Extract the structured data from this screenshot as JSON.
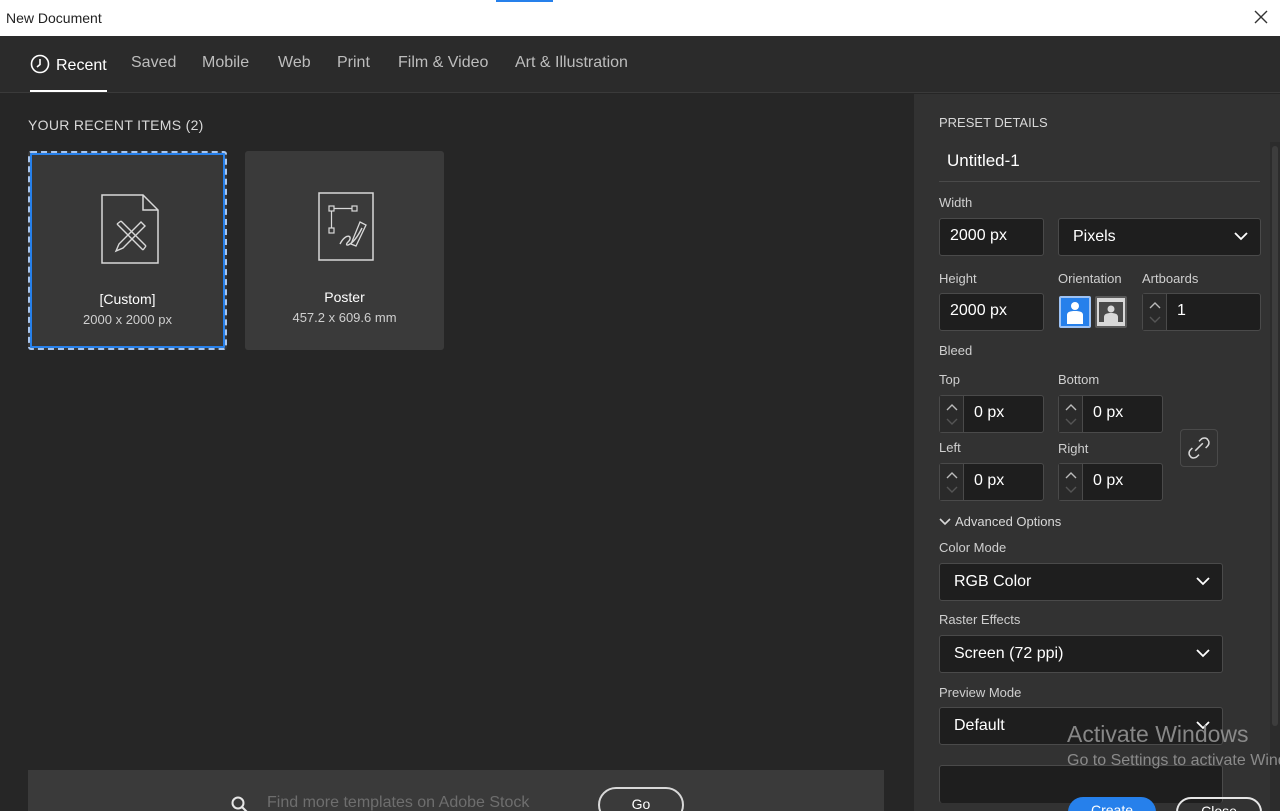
{
  "window": {
    "title": "New Document"
  },
  "tabs": [
    {
      "label": "Recent",
      "active": true
    },
    {
      "label": "Saved"
    },
    {
      "label": "Mobile"
    },
    {
      "label": "Web"
    },
    {
      "label": "Print"
    },
    {
      "label": "Film & Video"
    },
    {
      "label": "Art & Illustration"
    }
  ],
  "recent": {
    "heading": "YOUR RECENT ITEMS",
    "count": "(2)",
    "items": [
      {
        "name": "[Custom]",
        "size": "2000 x 2000 px",
        "icon": "document-ruler-pencil-icon",
        "selected": true
      },
      {
        "name": "Poster",
        "size": "457.2 x 609.6 mm",
        "icon": "document-pen-icon"
      }
    ]
  },
  "stock": {
    "placeholder": "Find more templates on Adobe Stock",
    "go_label": "Go"
  },
  "preset": {
    "heading": "PRESET DETAILS",
    "doc_name": "Untitled-1",
    "width_label": "Width",
    "width_value": "2000 px",
    "units_value": "Pixels",
    "height_label": "Height",
    "height_value": "2000 px",
    "orientation_label": "Orientation",
    "artboards_label": "Artboards",
    "artboards_value": "1",
    "bleed_label": "Bleed",
    "top_label": "Top",
    "top_value": "0 px",
    "bottom_label": "Bottom",
    "bottom_value": "0 px",
    "left_label": "Left",
    "left_value": "0 px",
    "right_label": "Right",
    "right_value": "0 px",
    "advanced_label": "Advanced Options",
    "color_mode_label": "Color Mode",
    "color_mode_value": "RGB Color",
    "raster_label": "Raster Effects",
    "raster_value": "Screen (72 ppi)",
    "preview_label": "Preview Mode",
    "preview_value": "Default"
  },
  "actions": {
    "create_label": "Create",
    "close_label": "Close"
  },
  "watermark": {
    "line1": "Activate Windows",
    "line2": "Go to Settings to activate Windows."
  },
  "colors": {
    "accent": "#2680eb",
    "panel": "#323232",
    "background": "#262626"
  }
}
